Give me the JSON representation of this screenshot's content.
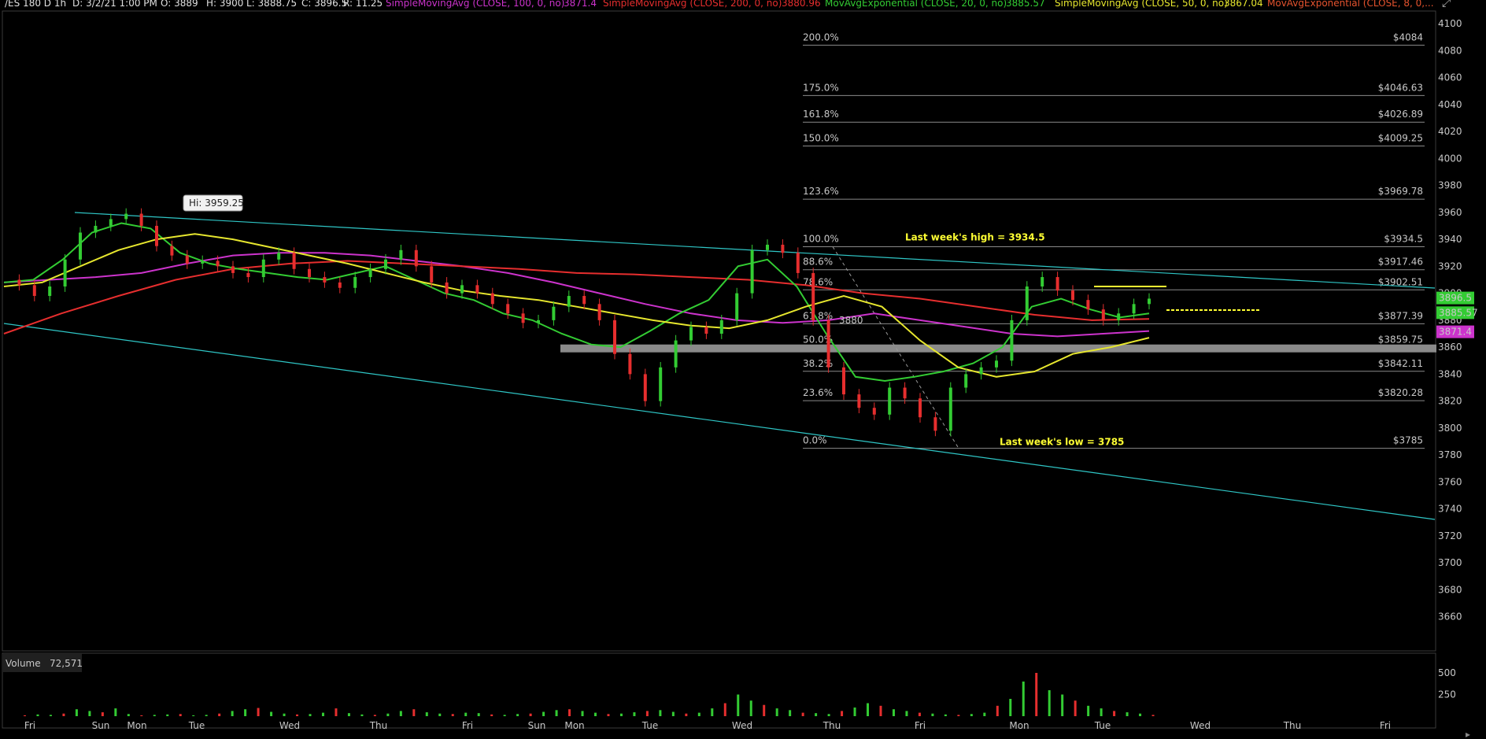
{
  "header": {
    "symbol": "/ES 180 D 1h",
    "date": "D: 3/2/21 1:00 PM",
    "open": "O: 3889",
    "high": "H: 3900",
    "low": "L: 3888.75",
    "close": "C: 3896.5",
    "range": "R: 11.25",
    "studies": [
      {
        "label": "SimpleMovingAvg (CLOSE, 100, 0, no)",
        "value": "3871.4",
        "color": "#cc33cc"
      },
      {
        "label": "SimpleMovingAvg (CLOSE, 200, 0, no)",
        "value": "3880.96",
        "color": "#e62e2e"
      },
      {
        "label": "MovAvgExponential (CLOSE, 20, 0, no)",
        "value": "3885.57",
        "color": "#33cc33"
      },
      {
        "label": "SimpleMovingAvg (CLOSE, 50, 0, no)",
        "value": "3867.04",
        "color": "#e6e62e"
      },
      {
        "label": "MovAvgExponential (CLOSE, 8, 0,...",
        "value": "",
        "color": "#e6532e"
      }
    ]
  },
  "chart_data": {
    "type": "line",
    "y_axis": {
      "ylim": [
        3640,
        4100
      ],
      "ticks": [
        4100,
        4080,
        4060,
        4040,
        4020,
        4000,
        3980,
        3960,
        3940,
        3920,
        3900,
        3880,
        3860,
        3840,
        3820,
        3800,
        3780,
        3760,
        3740,
        3720,
        3700,
        3680,
        3660
      ]
    },
    "x_axis": {
      "labels": [
        "Fri",
        "Sun",
        "Mon",
        "Tue",
        "Wed",
        "Thu",
        "Fri",
        "Sun",
        "Mon",
        "Tue",
        "Wed",
        "Thu",
        "Fri",
        "Mon",
        "Tue",
        "Wed",
        "Thu",
        "Fri"
      ]
    },
    "price_series": {
      "name": "price",
      "points": [
        3910,
        3906,
        3898,
        3905,
        3925,
        3945,
        3950,
        3955,
        3959,
        3950,
        3935,
        3928,
        3922,
        3924,
        3920,
        3915,
        3912,
        3925,
        3930,
        3918,
        3912,
        3908,
        3904,
        3912,
        3918,
        3925,
        3932,
        3920,
        3908,
        3900,
        3906,
        3900,
        3892,
        3885,
        3878,
        3880,
        3890,
        3898,
        3892,
        3880,
        3855,
        3840,
        3820,
        3845,
        3865,
        3875,
        3870,
        3880,
        3900,
        3932,
        3936,
        3930,
        3915,
        3880,
        3845,
        3825,
        3815,
        3810,
        3830,
        3822,
        3808,
        3798,
        3830,
        3840,
        3845,
        3850,
        3880,
        3905,
        3912,
        3902,
        3895,
        3888,
        3880,
        3885,
        3892,
        3896
      ]
    },
    "moving_averages": [
      {
        "name": "SMA 100",
        "color": "#cc33cc",
        "points": [
          3908,
          3910,
          3912,
          3915,
          3922,
          3928,
          3930,
          3930,
          3928,
          3924,
          3920,
          3915,
          3908,
          3900,
          3892,
          3885,
          3880,
          3878,
          3880,
          3885,
          3880,
          3875,
          3870,
          3868,
          3870,
          3872
        ]
      },
      {
        "name": "SMA 200",
        "color": "#e62e2e",
        "points": [
          3870,
          3885,
          3898,
          3910,
          3918,
          3922,
          3924,
          3922,
          3920,
          3918,
          3915,
          3914,
          3912,
          3910,
          3906,
          3900,
          3896,
          3890,
          3884,
          3880,
          3881
        ]
      },
      {
        "name": "EMA 20",
        "color": "#33cc33",
        "points": [
          3908,
          3910,
          3925,
          3945,
          3952,
          3948,
          3930,
          3922,
          3918,
          3915,
          3912,
          3910,
          3915,
          3920,
          3910,
          3900,
          3895,
          3885,
          3880,
          3870,
          3862,
          3860,
          3872,
          3885,
          3895,
          3920,
          3925,
          3905,
          3870,
          3838,
          3835,
          3838,
          3842,
          3848,
          3860,
          3890,
          3896,
          3888,
          3882,
          3885
        ]
      },
      {
        "name": "SMA 50",
        "color": "#e6e62e",
        "points": [
          3905,
          3908,
          3920,
          3932,
          3940,
          3944,
          3940,
          3934,
          3928,
          3922,
          3915,
          3908,
          3902,
          3898,
          3895,
          3890,
          3885,
          3880,
          3876,
          3874,
          3880,
          3890,
          3898,
          3890,
          3865,
          3845,
          3838,
          3842,
          3855,
          3860,
          3867
        ]
      }
    ],
    "volume": {
      "label": "Volume",
      "value": "72,571",
      "ylim": [
        0,
        500
      ],
      "ticks": [
        500,
        250
      ],
      "values": [
        10,
        20,
        15,
        30,
        80,
        60,
        45,
        90,
        25,
        10,
        15,
        20,
        25,
        10,
        15,
        30,
        60,
        80,
        95,
        50,
        30,
        20,
        25,
        40,
        90,
        35,
        20,
        15,
        30,
        60,
        80,
        45,
        30,
        25,
        40,
        35,
        20,
        15,
        25,
        30,
        50,
        70,
        80,
        60,
        40,
        25,
        30,
        45,
        60,
        70,
        50,
        30,
        40,
        90,
        150,
        250,
        180,
        130,
        90,
        70,
        40,
        35,
        25,
        60,
        100,
        150,
        120,
        80,
        60,
        40,
        30,
        20,
        15,
        25,
        40,
        120,
        200,
        400,
        500,
        300,
        250,
        180,
        120,
        90,
        60,
        45,
        30,
        15
      ]
    },
    "fibonacci": [
      {
        "pct": "200.0%",
        "price": "$4084",
        "value": 4084
      },
      {
        "pct": "175.0%",
        "price": "$4046.63",
        "value": 4046.63
      },
      {
        "pct": "161.8%",
        "price": "$4026.89",
        "value": 4026.89
      },
      {
        "pct": "150.0%",
        "price": "$4009.25",
        "value": 4009.25
      },
      {
        "pct": "123.6%",
        "price": "$3969.78",
        "value": 3969.78
      },
      {
        "pct": "100.0%",
        "price": "$3934.5",
        "value": 3934.5
      },
      {
        "pct": "88.6%",
        "price": "$3917.46",
        "value": 3917.46
      },
      {
        "pct": "78.6%",
        "price": "$3902.51",
        "value": 3902.51
      },
      {
        "pct": "61.8%",
        "price": "$3877.39",
        "value": 3877.39
      },
      {
        "pct": "50.0%",
        "price": "$3859.75",
        "value": 3859.75
      },
      {
        "pct": "38.2%",
        "price": "$3842.11",
        "value": 3842.11
      },
      {
        "pct": "23.6%",
        "price": "$3820.28",
        "value": 3820.28
      },
      {
        "pct": "0.0%",
        "price": "$3785",
        "value": 3785
      }
    ],
    "price_badges": [
      {
        "text": "3896.5",
        "value": 3896.5,
        "color": "#33cc33"
      },
      {
        "text": "3885.57",
        "value": 3885.57,
        "color": "#33cc33"
      },
      {
        "text": "3871.4",
        "value": 3871.4,
        "color": "#cc33cc"
      },
      {
        "text": "3880",
        "value": 3880
      }
    ],
    "annotations": [
      {
        "text": "Last week's high = 3934.5",
        "value": 3934.5
      },
      {
        "text": "Last week's low = 3785",
        "value": 3785
      },
      {
        "text": "Hi: 3959.25",
        "value": 3959.25
      }
    ]
  }
}
